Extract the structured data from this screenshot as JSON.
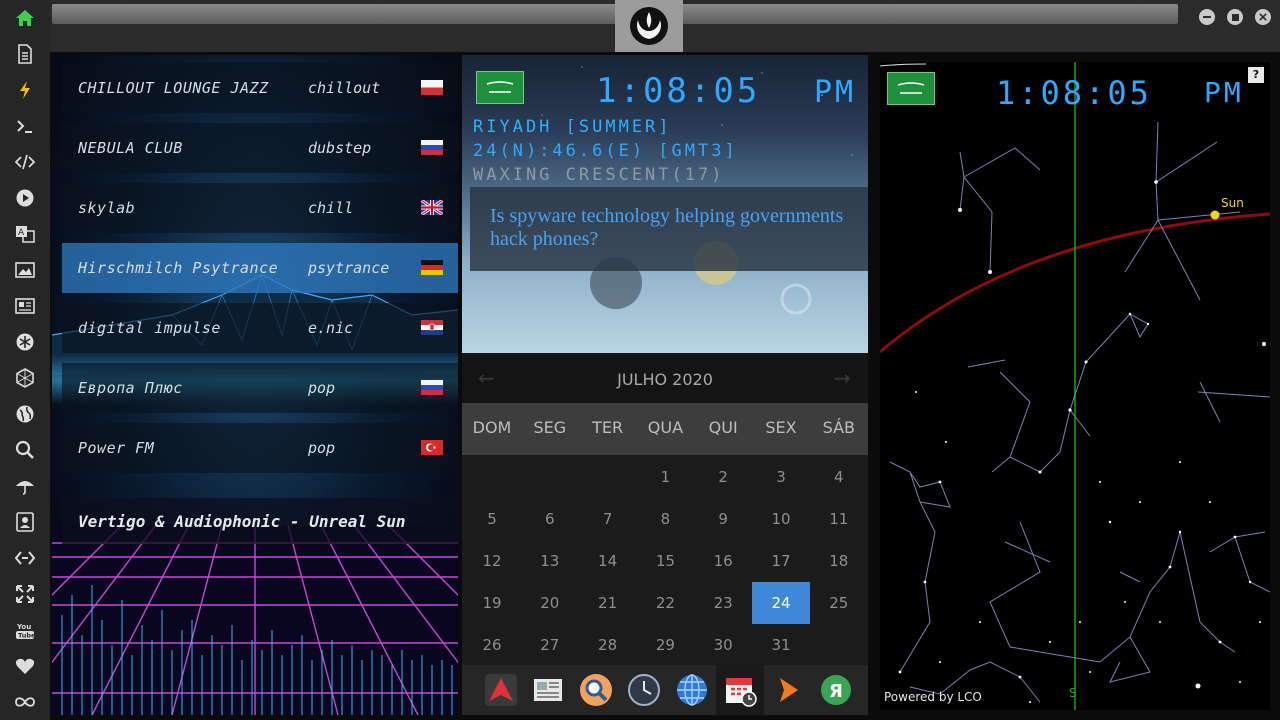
{
  "radio": {
    "stations": [
      {
        "name": "CHILLOUT LOUNGE JAZZ",
        "genre": "chillout",
        "flag": "poland-flag",
        "active": false
      },
      {
        "name": "NEBULA CLUB",
        "genre": "dubstep",
        "flag": "russia-flag",
        "active": false
      },
      {
        "name": "skylab",
        "genre": "chill",
        "flag": "uk-flag",
        "active": false
      },
      {
        "name": "Hirschmilch Psytrance",
        "genre": "psytrance",
        "flag": "germany-flag",
        "active": true
      },
      {
        "name": "digital impulse",
        "genre": "e.nic",
        "flag": "croatia-flag",
        "active": false
      },
      {
        "name": "Европа Плюс",
        "genre": "pop",
        "flag": "russia-flag",
        "active": false
      },
      {
        "name": "Power FM",
        "genre": "pop",
        "flag": "turkey-flag",
        "active": false
      }
    ],
    "now_playing": "Vertigo & Audiophonic - Unreal Sun"
  },
  "clock": {
    "time": "1:08:05",
    "ampm": "PM",
    "city": "RIYADH [SUMMER]",
    "coords": "24(N):46.6(E) [GMT3]",
    "moon": "WAXING CRESCENT(17)"
  },
  "news": {
    "headline": "Is spyware technology helping governments hack phones?"
  },
  "calendar": {
    "month_label": "JULHO 2020",
    "weekdays": [
      "DOM",
      "SEG",
      "TER",
      "QUA",
      "QUI",
      "SEX",
      "SÁB"
    ],
    "first_weekday_index": 3,
    "days_in_month": 31,
    "selected_day": 24,
    "prev_icon": "←",
    "next_icon": "→"
  },
  "starmap": {
    "time": "1:08:05",
    "ampm": "PM",
    "sun_label": "Sun",
    "south_label": "S",
    "help_label": "?",
    "powered_by": "Powered by LCO"
  },
  "colors": {
    "accent_blue": "#2fa8ff",
    "selected_day": "#3f88d8",
    "headline_blue": "#4aa2f2",
    "launcher_green": "#3ecf4f"
  }
}
